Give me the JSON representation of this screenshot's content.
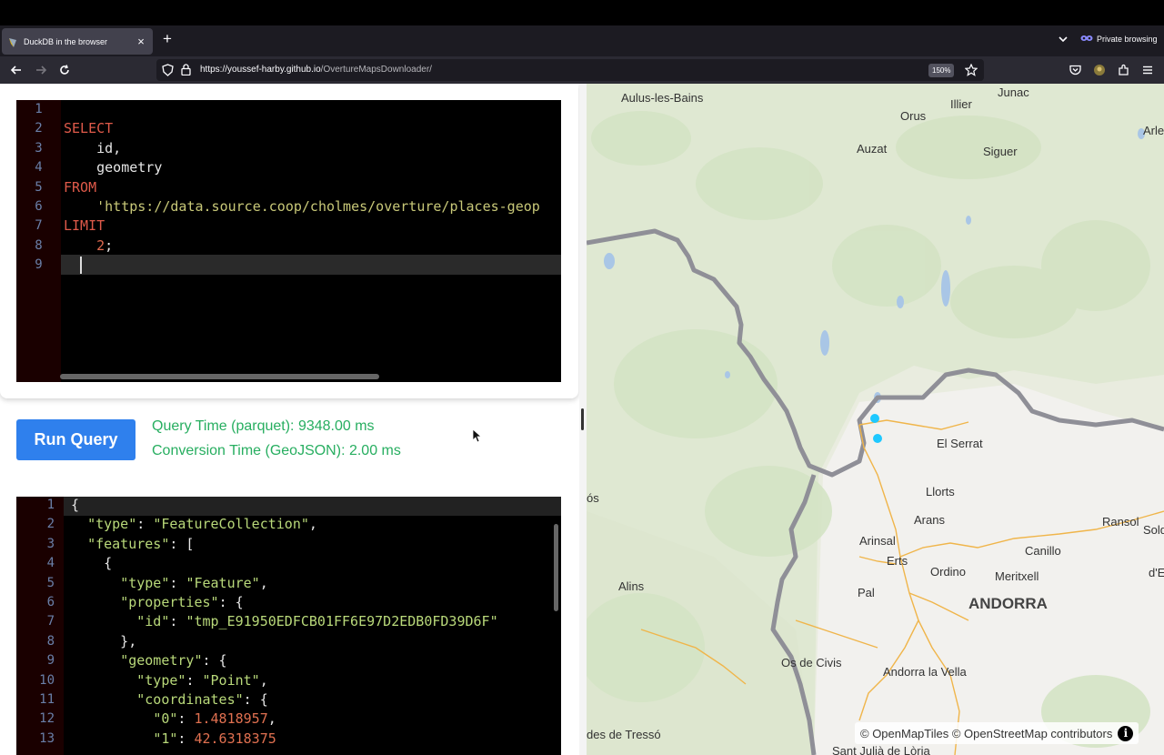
{
  "browser": {
    "tab_title": "DuckDB in the browser",
    "tab_close": "×",
    "new_tab": "+",
    "private_label": "Private browsing",
    "url_host": "https://youssef-harby.github.io",
    "url_path": "/OvertureMapsDownloader/",
    "zoom": "150%"
  },
  "query_editor": {
    "line_numbers": [
      "1",
      "2",
      "3",
      "4",
      "5",
      "6",
      "7",
      "8",
      "9"
    ],
    "lines": [
      "",
      "SELECT",
      "    id,",
      "    geometry",
      "FROM",
      "    'https://data.source.coop/cholmes/overture/places-geop",
      "LIMIT",
      "    2;",
      ""
    ]
  },
  "controls": {
    "run_label": "Run Query",
    "query_time": "Query Time (parquet): 9348.00 ms",
    "conversion_time": "Conversion Time (GeoJSON): 2.00 ms"
  },
  "result_editor": {
    "line_numbers": [
      "1",
      "2",
      "3",
      "4",
      "5",
      "6",
      "7",
      "8",
      "9",
      "10",
      "11",
      "12",
      "13"
    ],
    "lines": [
      "{",
      "  \"type\": \"FeatureCollection\",",
      "  \"features\": [",
      "    {",
      "      \"type\": \"Feature\",",
      "      \"properties\": {",
      "        \"id\": \"tmp_E91950EDFCB01FF6E97D2EDB0FD39D6F\"",
      "      },",
      "      \"geometry\": {",
      "        \"type\": \"Point\",",
      "        \"coordinates\": {",
      "          \"0\": 1.4818957,",
      "          \"1\": 42.6318375"
    ]
  },
  "map": {
    "places": [
      {
        "name": "Aulus-les-Bains",
        "big": false
      },
      {
        "name": "Junac",
        "big": false
      },
      {
        "name": "Orus",
        "big": false
      },
      {
        "name": "Illier",
        "big": false
      },
      {
        "name": "Auzat",
        "big": false
      },
      {
        "name": "Siguer",
        "big": false
      },
      {
        "name": "El Serrat",
        "big": false
      },
      {
        "name": "Llorts",
        "big": false
      },
      {
        "name": "Arans",
        "big": false
      },
      {
        "name": "Ransol",
        "big": false
      },
      {
        "name": "Arinsal",
        "big": false
      },
      {
        "name": "Erts",
        "big": false
      },
      {
        "name": "Canillo",
        "big": false
      },
      {
        "name": "Ordino",
        "big": false
      },
      {
        "name": "Meritxell",
        "big": false
      },
      {
        "name": "Alins",
        "big": false
      },
      {
        "name": "Pal",
        "big": false
      },
      {
        "name": "ANDORRA",
        "big": true
      },
      {
        "name": "Os de Civis",
        "big": false
      },
      {
        "name": "Andorra la Vella",
        "big": false
      },
      {
        "name": "des de Tressó",
        "big": false
      },
      {
        "name": "Sant Julià de Lòria",
        "big": false
      },
      {
        "name": "Solde",
        "big": false
      },
      {
        "name": "d'E",
        "big": false
      },
      {
        "name": "ós",
        "big": false
      },
      {
        "name": "Arles",
        "big": false
      }
    ],
    "attribution": "© OpenMapTiles © OpenStreetMap contributors",
    "info": "i",
    "point_color": "#1ec8ff"
  }
}
